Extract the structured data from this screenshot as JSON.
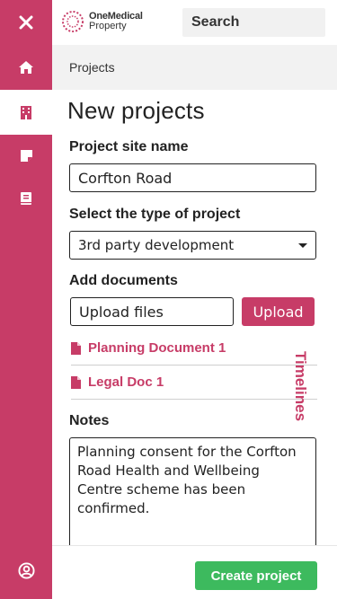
{
  "app": {
    "brand_line1": "OneMedical",
    "brand_line2": "Property"
  },
  "colors": {
    "accent": "#c73c67",
    "success": "#3dba5e",
    "breadcrumb_bg": "#f2f2f2"
  },
  "sidebar": {
    "items": [
      {
        "icon": "close-icon",
        "active": false
      },
      {
        "icon": "home-icon",
        "active": false
      },
      {
        "icon": "building-icon",
        "active": true
      },
      {
        "icon": "note-icon",
        "active": false
      },
      {
        "icon": "book-icon",
        "active": false
      },
      {
        "icon": "user-circle-icon",
        "active": false
      }
    ]
  },
  "search": {
    "placeholder": "Search",
    "value": ""
  },
  "breadcrumb": {
    "current": "Projects"
  },
  "page": {
    "title": "New projects"
  },
  "form": {
    "site_name_label": "Project site name",
    "site_name_value": "Corfton Road",
    "type_label": "Select the type of project",
    "type_value": "3rd party development",
    "documents_label": "Add documents",
    "upload_field_text": "Upload files",
    "upload_button": "Upload",
    "documents": [
      {
        "name": "Planning Document 1",
        "icon": "file-icon"
      },
      {
        "name": "Legal Doc 1",
        "icon": "file-icon"
      }
    ],
    "side_tab": "Timelines",
    "notes_label": "Notes",
    "notes_value": "Planning consent for the Corfton Road Health and Wellbeing Centre scheme has been confirmed."
  },
  "footer": {
    "create_button": "Create project"
  }
}
